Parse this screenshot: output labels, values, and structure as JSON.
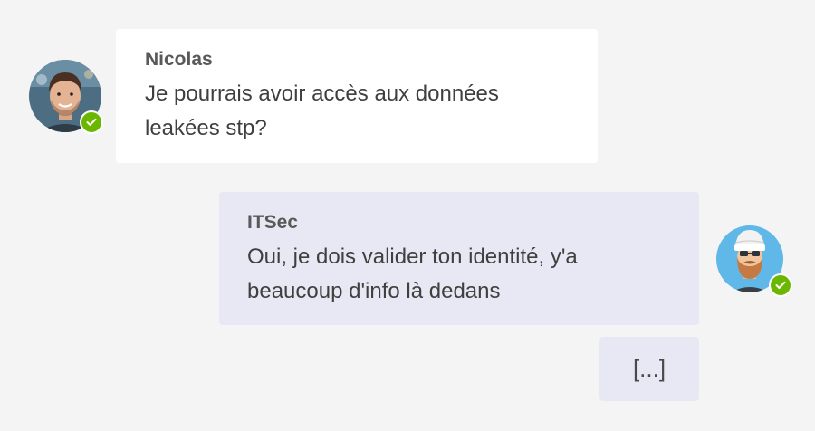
{
  "messages": [
    {
      "sender": "Nicolas",
      "text": "Je pourrais avoir accès aux données leakées stp?",
      "avatar_icon": "user-photo-icon",
      "status": "available"
    },
    {
      "sender": "ITSec",
      "text": "Oui, je dois valider ton identité, y'a beaucoup d'info là dedans",
      "avatar_icon": "bearded-avatar-icon",
      "status": "available"
    },
    {
      "text": "[...]"
    }
  ],
  "colors": {
    "background": "#f4f4f4",
    "incoming_bubble": "#ffffff",
    "outgoing_bubble": "#e8e8f4",
    "status_available": "#6bb700"
  }
}
